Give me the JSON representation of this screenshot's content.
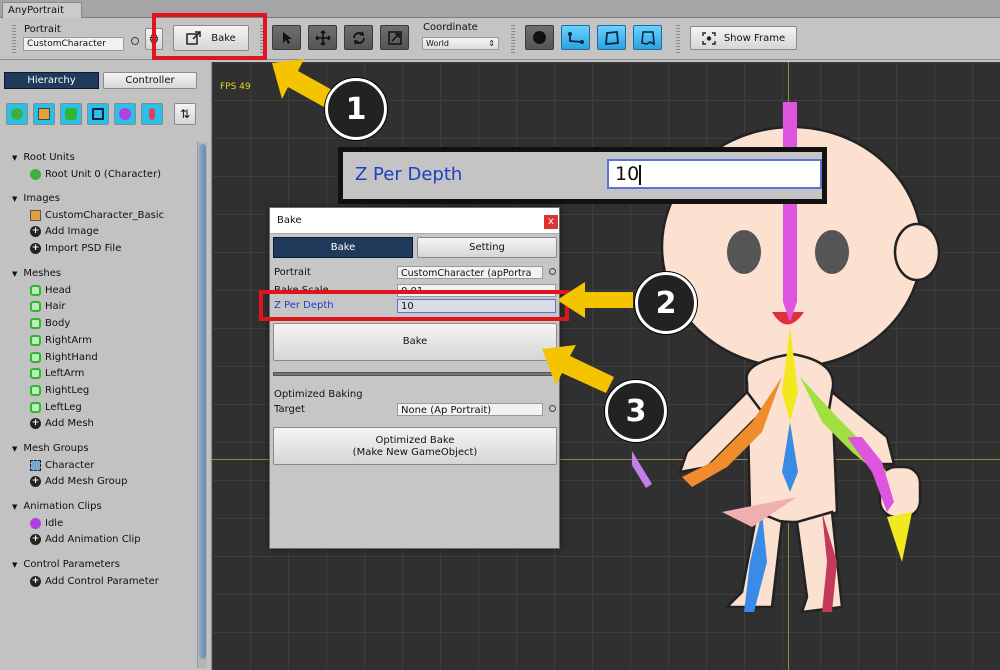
{
  "window_tab": "AnyPortrait",
  "toolbar": {
    "portrait_label": "Portrait",
    "portrait_value": "CustomCharacter",
    "bake_label": "Bake",
    "coordinate_label": "Coordinate",
    "coordinate_value": "World",
    "show_frame_label": "Show Frame"
  },
  "left": {
    "tab_hierarchy": "Hierarchy",
    "tab_controller": "Controller",
    "sections": [
      {
        "title": "Root Units",
        "items": [
          "Root Unit 0 (Character)"
        ]
      },
      {
        "title": "Images",
        "items": [
          "CustomCharacter_Basic",
          "Add Image",
          "Import PSD File"
        ]
      },
      {
        "title": "Meshes",
        "items": [
          "Head",
          "Hair",
          "Body",
          "RightArm",
          "RightHand",
          "LeftArm",
          "RightLeg",
          "LeftLeg",
          "Add Mesh"
        ]
      },
      {
        "title": "Mesh Groups",
        "items": [
          "Character",
          "Add Mesh Group"
        ]
      },
      {
        "title": "Animation Clips",
        "items": [
          "Idle",
          "Add Animation Clip"
        ]
      },
      {
        "title": "Control Parameters",
        "items": [
          "Add Control Parameter"
        ]
      }
    ]
  },
  "viewport": {
    "fps": "FPS 49"
  },
  "callout": {
    "label": "Z Per Depth",
    "value": "10"
  },
  "bake_window": {
    "title": "Bake",
    "close": "x",
    "tab_bake": "Bake",
    "tab_setting": "Setting",
    "portrait_label": "Portrait",
    "portrait_value": "CustomCharacter (apPortra",
    "bake_scale_label": "Bake Scale",
    "bake_scale_value": "0.01",
    "z_label": "Z Per Depth",
    "z_value": "10",
    "bake_button": "Bake",
    "optimized_title": "Optimized Baking",
    "target_label": "Target",
    "target_value": "None (Ap Portrait)",
    "opt_button_line1": "Optimized Bake",
    "opt_button_line2": "(Make New GameObject)"
  },
  "steps": [
    "1",
    "2",
    "3"
  ],
  "colors": {
    "highlight": "#e0141e",
    "arrow": "#f5c400",
    "blue_label": "#1c3fc4",
    "tab_active": "#1f3a5a"
  }
}
